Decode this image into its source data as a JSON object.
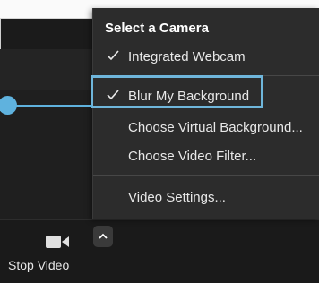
{
  "menu": {
    "header": "Select a Camera",
    "items": [
      {
        "label": "Integrated Webcam",
        "checked": true
      },
      {
        "label": "Blur My Background",
        "checked": true
      },
      {
        "label": "Choose Virtual Background...",
        "checked": false
      },
      {
        "label": "Choose Video Filter...",
        "checked": false
      },
      {
        "label": "Video Settings...",
        "checked": false
      }
    ]
  },
  "toolbar": {
    "stop_video_label": "Stop Video",
    "camera_icon": "video-camera-icon",
    "caret_icon": "chevron-up-icon"
  },
  "colors": {
    "highlight": "#6fb6db",
    "menu_bg": "#2c2c2c",
    "toolbar_bg": "#1a1a1a"
  }
}
